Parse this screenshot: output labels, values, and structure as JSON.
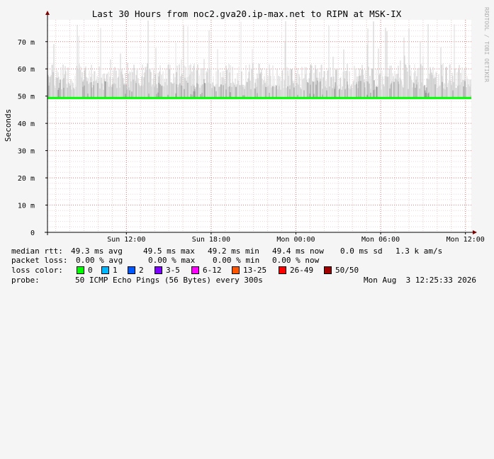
{
  "chart_data": {
    "type": "area",
    "title": "Last 30 Hours from noc2.gva20.ip-max.net to RIPN at MSK-IX",
    "ylabel": "Seconds",
    "side_label": "RRDTOOL / TOBI OETIKER",
    "ylim": [
      0,
      0.078
    ],
    "y_ticks": [
      {
        "value": 0,
        "label": "0"
      },
      {
        "value": 0.01,
        "label": "10 m"
      },
      {
        "value": 0.02,
        "label": "20 m"
      },
      {
        "value": 0.03,
        "label": "30 m"
      },
      {
        "value": 0.04,
        "label": "40 m"
      },
      {
        "value": 0.05,
        "label": "50 m"
      },
      {
        "value": 0.06,
        "label": "60 m"
      },
      {
        "value": 0.07,
        "label": "70 m"
      }
    ],
    "x_range": [
      "Sun Aug 2 06:25",
      "Mon Aug 3 12:25"
    ],
    "x_ticks": [
      {
        "value": "Sun 12:00",
        "label": "Sun 12:00"
      },
      {
        "value": "Sun 18:00",
        "label": "Sun 18:00"
      },
      {
        "value": "Mon 00:00",
        "label": "Mon 00:00"
      },
      {
        "value": "Mon 06:00",
        "label": "Mon 06:00"
      },
      {
        "value": "Mon 12:00",
        "label": "Mon 12:00"
      }
    ],
    "grid": true,
    "median_rtt_level": 0.0493,
    "smoke_min": 0.0492,
    "smoke_typical_max": 0.062,
    "smoke_peak_max": 0.078,
    "median_color": "#00ff00",
    "smoke_color": "#c8c8c8"
  },
  "legend": {
    "median": {
      "label": "median rtt:",
      "avg": "49.3 ms avg",
      "max": "49.5 ms max",
      "min": "49.2 ms min",
      "now": "49.4 ms now",
      "sd": "0.0 ms sd",
      "am": "1.3 k am/s"
    },
    "loss": {
      "label": "packet loss:",
      "avg": "0.00 % avg",
      "max": "0.00 % max",
      "min": "0.00 % min",
      "now": "0.00 % now"
    },
    "loss_color": {
      "label": "loss color:",
      "items": [
        {
          "label": "0",
          "color": "#00ff00"
        },
        {
          "label": "1",
          "color": "#00b8ff"
        },
        {
          "label": "2",
          "color": "#0059ff"
        },
        {
          "label": "3-5",
          "color": "#7e00ff"
        },
        {
          "label": "6-12",
          "color": "#ff00ff"
        },
        {
          "label": "13-25",
          "color": "#ff5500"
        },
        {
          "label": "26-49",
          "color": "#ff0000"
        },
        {
          "label": "50/50",
          "color": "#a10000"
        }
      ]
    },
    "probe": {
      "label": "probe:",
      "desc": "50 ICMP Echo Pings (56 Bytes) every 300s",
      "date": "Mon Aug  3 12:25:33 2026"
    }
  }
}
